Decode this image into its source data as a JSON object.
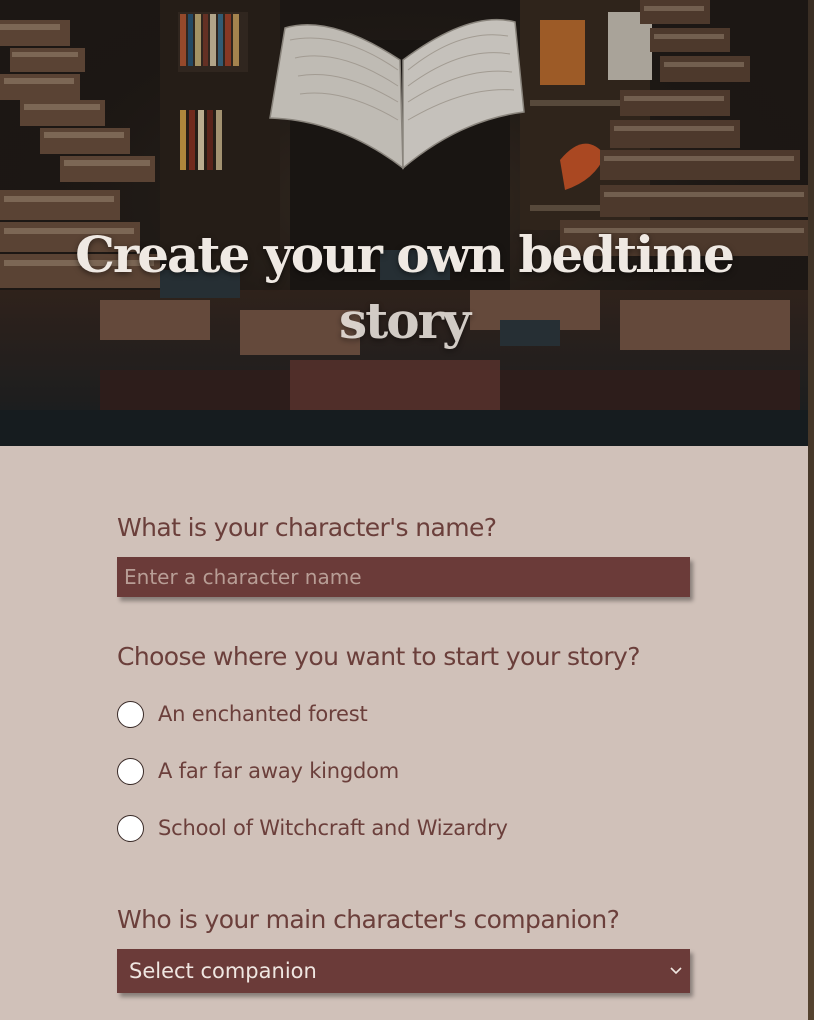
{
  "hero": {
    "title_line1": "Create your own bedtime",
    "title_line2": "story"
  },
  "form": {
    "name_question": "What is your character's name?",
    "name_placeholder": "Enter a character name",
    "name_value": "",
    "location_question": "Choose where you want to start your story?",
    "location_options": [
      {
        "label": "An enchanted forest",
        "selected": false
      },
      {
        "label": "A far far away kingdom",
        "selected": false
      },
      {
        "label": "School of Witchcraft and Wizardry",
        "selected": false
      }
    ],
    "companion_question": "Who is your main character's companion?",
    "companion_selected": "Select companion"
  },
  "icons": {
    "radio": "radio-unchecked-icon",
    "dropdown": "chevron-down-icon"
  },
  "colors": {
    "background": "#d0c1b9",
    "question_text": "#6b3f3b",
    "input_fill": "#6b3b39",
    "hero_title": "#efe9e3"
  }
}
